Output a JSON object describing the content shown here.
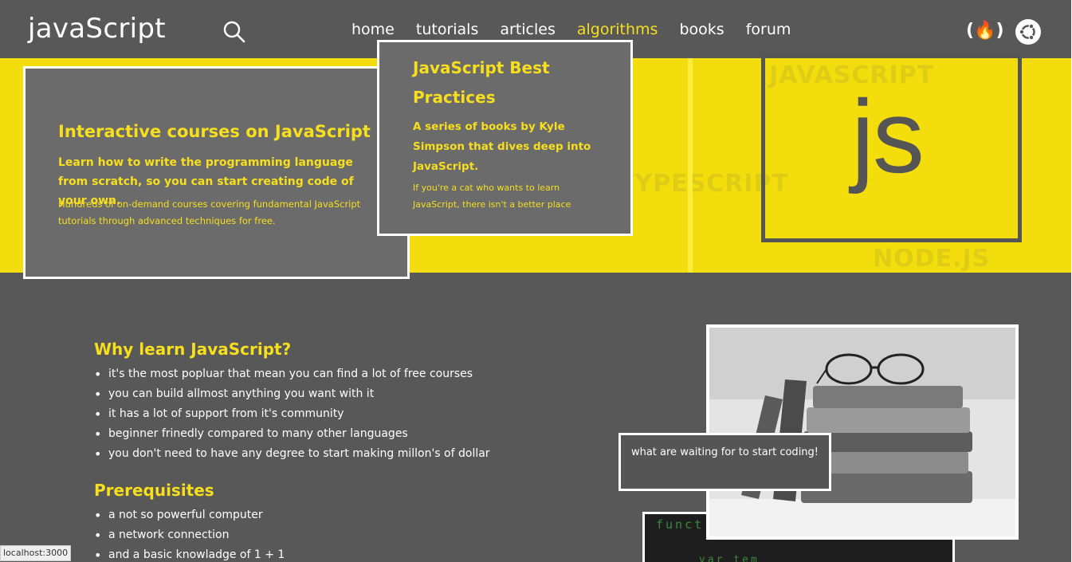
{
  "navbar": {
    "logo": "javaScript",
    "links": [
      {
        "label": "home",
        "active": false
      },
      {
        "label": "tutorials",
        "active": false
      },
      {
        "label": "articles",
        "active": false
      },
      {
        "label": "algorithms",
        "active": true
      },
      {
        "label": "books",
        "active": false
      },
      {
        "label": "forum",
        "active": false
      }
    ],
    "fcc_icon": "(🔥)",
    "icons": [
      "search-icon",
      "freecodecamp-icon",
      "ubuntu-icon"
    ]
  },
  "hero": {
    "watermarks": [
      "JAVASCRIPT",
      "TYPESCRIPT",
      "NODE.JS"
    ],
    "card1": {
      "title": "Interactive courses on JavaScript",
      "lead": "Learn how to write the programming language from scratch, so you can start creating code of your own.",
      "sub": "Hundreds of on-demand courses covering fundamental JavaScript tutorials through advanced techniques for free."
    },
    "card2": {
      "title": "JavaScript Best Practices",
      "lead": "A series of books by Kyle Simpson that dives deep into JavaScript.",
      "sub": "If you're a cat who wants to learn JavaScript, there isn't a better place"
    },
    "js_logo": "js"
  },
  "why": {
    "title": "Why learn JavaScript?",
    "items": [
      "it's the most popluar that mean you can find a lot of free courses",
      "you can build allmost anything you want with it",
      "it has a lot of support from it's community",
      "beginner frinedly compared to many other languages",
      "you don't need to have any degree to start making millon's of dollar"
    ]
  },
  "prereq": {
    "title": "Prerequisites",
    "items": [
      "a not so powerful computer",
      "a network connection",
      "and a basic knowladge of 1 + 1"
    ]
  },
  "cta": "what are waiting for to start coding!",
  "code_snippet": {
    "line1": "funct",
    "line2": "var tem"
  },
  "status_bar": "localhost:3000",
  "colors": {
    "accent": "#f7df1e",
    "background": "#585858",
    "card": "#6b6b6b",
    "hero": "#f3dd0c"
  }
}
